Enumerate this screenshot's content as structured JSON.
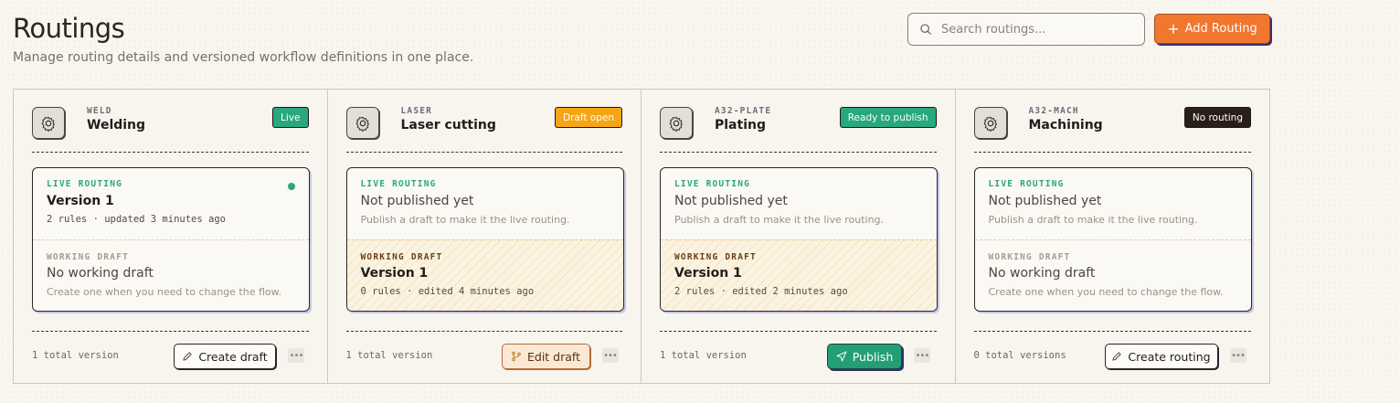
{
  "header": {
    "title": "Routings",
    "subtitle": "Manage routing details and versioned workflow definitions in one place."
  },
  "search": {
    "placeholder": "Search routings..."
  },
  "add_button": {
    "label": "Add Routing",
    "icon": "plus-icon"
  },
  "colors": {
    "accent": "#f1772f",
    "live": "#28a87c",
    "draft": "#f5a516",
    "dark": "#2a1e18"
  },
  "cards": [
    {
      "code": "WELD",
      "name": "Welding",
      "badge": "Live",
      "live_label": "LIVE ROUTING",
      "live_title": "Version 1",
      "live_sub": "2 rules · updated 3 minutes ago",
      "draft_label": "WORKING DRAFT",
      "draft_title": "No working draft",
      "draft_sub": "Create one when you need to change the flow.",
      "footer_count": "1 total version",
      "action": "Create draft",
      "more": "•••"
    },
    {
      "code": "LASER",
      "name": "Laser cutting",
      "badge": "Draft open",
      "live_label": "LIVE ROUTING",
      "live_title": "Not published yet",
      "live_sub": "Publish a draft to make it the live routing.",
      "draft_label": "WORKING DRAFT",
      "draft_title": "Version 1",
      "draft_sub": "0 rules · edited 4 minutes ago",
      "footer_count": "1 total version",
      "action": "Edit draft",
      "more": "•••"
    },
    {
      "code": "A32-PLATE",
      "name": "Plating",
      "badge": "Ready to publish",
      "live_label": "LIVE ROUTING",
      "live_title": "Not published yet",
      "live_sub": "Publish a draft to make it the live routing.",
      "draft_label": "WORKING DRAFT",
      "draft_title": "Version 1",
      "draft_sub": "2 rules · edited 2 minutes ago",
      "footer_count": "1 total version",
      "action": "Publish",
      "more": "•••"
    },
    {
      "code": "A32-MACH",
      "name": "Machining",
      "badge": "No routing",
      "live_label": "LIVE ROUTING",
      "live_title": "Not published yet",
      "live_sub": "Publish a draft to make it the live routing.",
      "draft_label": "WORKING DRAFT",
      "draft_title": "No working draft",
      "draft_sub": "Create one when you need to change the flow.",
      "footer_count": "0 total versions",
      "action": "Create routing",
      "more": "•••"
    }
  ]
}
